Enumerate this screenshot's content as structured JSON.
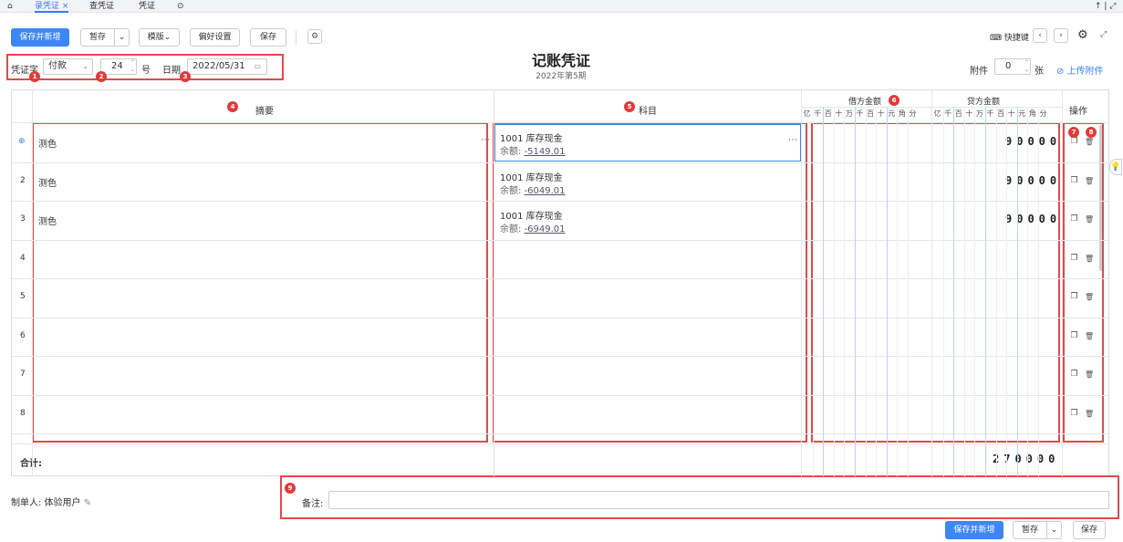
{
  "tabs": [
    {
      "label": "录凭证",
      "active": true
    },
    {
      "label": "查凭证",
      "active": false
    },
    {
      "label": "凭证",
      "active": false
    }
  ],
  "toolbar": {
    "save_new": "保存并新增",
    "temp_save": "暂存",
    "template": "模版",
    "preference": "偏好设置",
    "save": "保存",
    "shortcut": "快捷键"
  },
  "voucher": {
    "title": "记账凭证",
    "period": "2022年第5期",
    "word_label": "凭证字",
    "word_value": "付款",
    "number_value": "24",
    "number_unit": "号",
    "date_label": "日期",
    "date_value": "2022/05/31",
    "attach_label": "附件",
    "attach_value": "0",
    "attach_unit": "张",
    "upload": "上传附件"
  },
  "table": {
    "col_summary": "摘要",
    "col_account": "科目",
    "col_debit": "借方金额",
    "col_credit": "贷方金额",
    "col_ops": "操作",
    "digit_headers": [
      "亿",
      "千",
      "百",
      "十",
      "万",
      "千",
      "百",
      "十",
      "元",
      "角",
      "分"
    ],
    "rows": [
      {
        "num": "",
        "summary": "测色",
        "account": "1001  库存现金",
        "balance_label": "余额:",
        "balance": "-5149.01",
        "credit": "90000"
      },
      {
        "num": "2",
        "summary": "测色",
        "account": "1001  库存现金",
        "balance_label": "余额:",
        "balance": "-6049.01",
        "credit": "90000"
      },
      {
        "num": "3",
        "summary": "测色",
        "account": "1001  库存现金",
        "balance_label": "余额:",
        "balance": "-6949.01",
        "credit": "90000"
      },
      {
        "num": "4",
        "summary": "",
        "account": "",
        "balance_label": "",
        "balance": "",
        "credit": ""
      },
      {
        "num": "5",
        "summary": "",
        "account": "",
        "balance_label": "",
        "balance": "",
        "credit": ""
      },
      {
        "num": "6",
        "summary": "",
        "account": "",
        "balance_label": "",
        "balance": "",
        "credit": ""
      },
      {
        "num": "7",
        "summary": "",
        "account": "",
        "balance_label": "",
        "balance": "",
        "credit": ""
      },
      {
        "num": "8",
        "summary": "",
        "account": "",
        "balance_label": "",
        "balance": "",
        "credit": ""
      }
    ],
    "total_label": "合计:",
    "total_credit": "270000"
  },
  "footer": {
    "maker": "制单人: 体验用户",
    "remark_label": "备注:",
    "remark_value": "",
    "save_new": "保存并新增",
    "temp_save": "暂存",
    "save": "保存"
  },
  "markers": [
    "1",
    "2",
    "3",
    "4",
    "5",
    "6",
    "7",
    "8",
    "9"
  ],
  "colors": {
    "accent": "#3d86f5",
    "annotation": "#e24a4a"
  }
}
